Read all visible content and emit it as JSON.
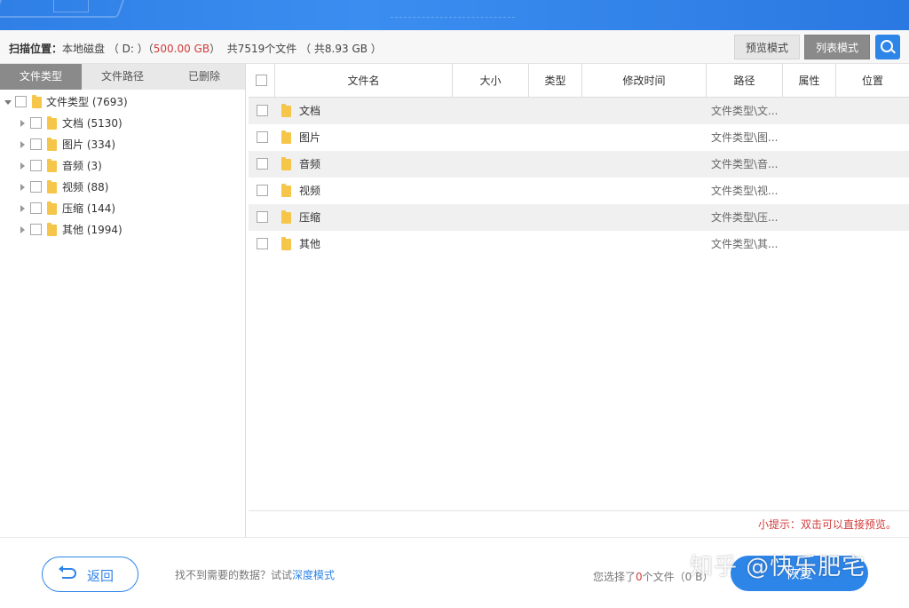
{
  "scan": {
    "label": "扫描位置：",
    "location": "本地磁盘 （ D: ）（",
    "size": "500.00 GB",
    "size_close": "）",
    "total": "共7519个文件 （ 共8.93 GB ）"
  },
  "modes": {
    "preview": "预览模式",
    "list": "列表模式"
  },
  "left_tabs": [
    "文件类型",
    "文件路径",
    "已删除"
  ],
  "tree": {
    "root": "文件类型 (7693)",
    "children": [
      "文档 (5130)",
      "图片 (334)",
      "音频 (3)",
      "视频 (88)",
      "压缩 (144)",
      "其他 (1994)"
    ]
  },
  "table": {
    "columns": [
      "文件名",
      "大小",
      "类型",
      "修改时间",
      "路径",
      "属性",
      "位置"
    ],
    "rows": [
      {
        "name": "文档",
        "path": "文件类型\\文..."
      },
      {
        "name": "图片",
        "path": "文件类型\\图..."
      },
      {
        "name": "音频",
        "path": "文件类型\\音..."
      },
      {
        "name": "视频",
        "path": "文件类型\\视..."
      },
      {
        "name": "压缩",
        "path": "文件类型\\压..."
      },
      {
        "name": "其他",
        "path": "文件类型\\其..."
      }
    ]
  },
  "hint": "小提示：双击可以直接预览。",
  "footer": {
    "back": "返回",
    "tip": "找不到需要的数据？试试",
    "tip_link": "深度模式",
    "selected_prefix": "您选择了",
    "selected_count": "0",
    "selected_suffix": "个文件（0 B）",
    "recover": "恢复",
    "watermark": "知乎 @快乐肥宅"
  },
  "colors": {
    "accent": "#2e85e8",
    "warning": "#d23b3b",
    "folder": "#f5c64a",
    "tab_active": "#8a8a8a"
  }
}
